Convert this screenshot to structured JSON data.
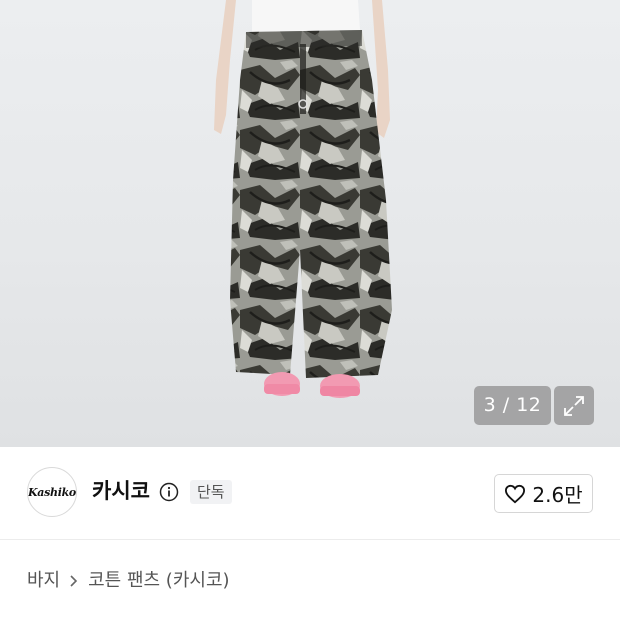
{
  "gallery": {
    "counter": "3 / 12",
    "expand_icon": "expand-arrows-icon"
  },
  "brand": {
    "logo_text": "Kashiko",
    "name": "카시코",
    "info_icon": "info-icon",
    "badge": "단독",
    "like_icon": "heart-icon",
    "like_count": "2.6만"
  },
  "breadcrumb": {
    "items": [
      "바지",
      "코튼 팬츠 (카시코)"
    ],
    "separator_icon": "chevron-right-icon"
  },
  "product": {
    "title_partial": ""
  },
  "colors": {
    "counter_bg": "#8c8c8c",
    "badge_bg": "#f1f2f4"
  }
}
